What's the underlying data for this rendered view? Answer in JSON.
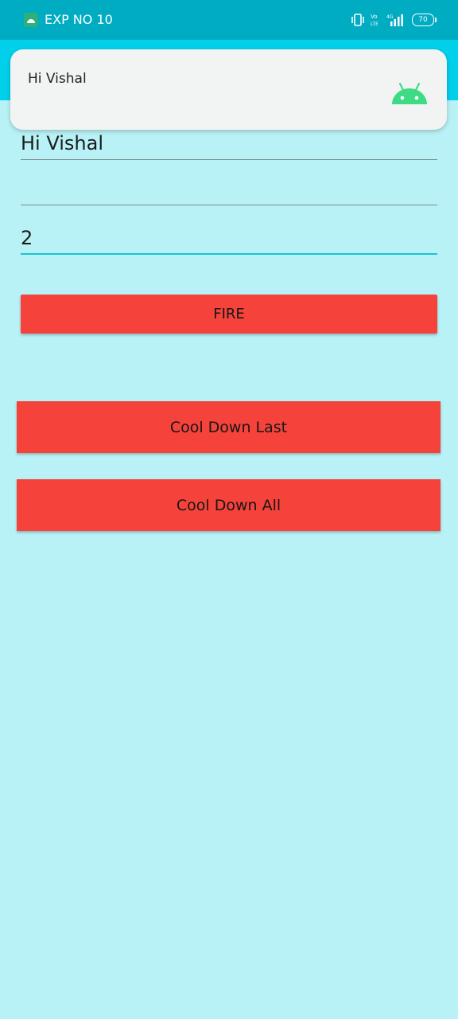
{
  "status_bar": {
    "title": "EXP NO 10",
    "battery": "70",
    "icons": [
      "app-icon",
      "vibrate-icon",
      "volte-icon",
      "4g-signal-icon",
      "battery-icon"
    ],
    "volte_text": "Vo\nLTE",
    "network_text": "4G",
    "background_color": "#00acc1"
  },
  "notification": {
    "text": "Hi Vishal",
    "icon": "android-icon",
    "icon_color": "#3ddc84"
  },
  "form": {
    "message_value": "Hi Vishal",
    "blank_value": "",
    "count_value": "2"
  },
  "buttons": {
    "fire": "FIRE",
    "cool_down_last": "Cool Down Last",
    "cool_down_all": "Cool Down All",
    "color": "#f5433b"
  },
  "colors": {
    "background": "#b9f2f6",
    "toolbar": "#00d0ea",
    "focus_underline": "#1bc3d3"
  }
}
